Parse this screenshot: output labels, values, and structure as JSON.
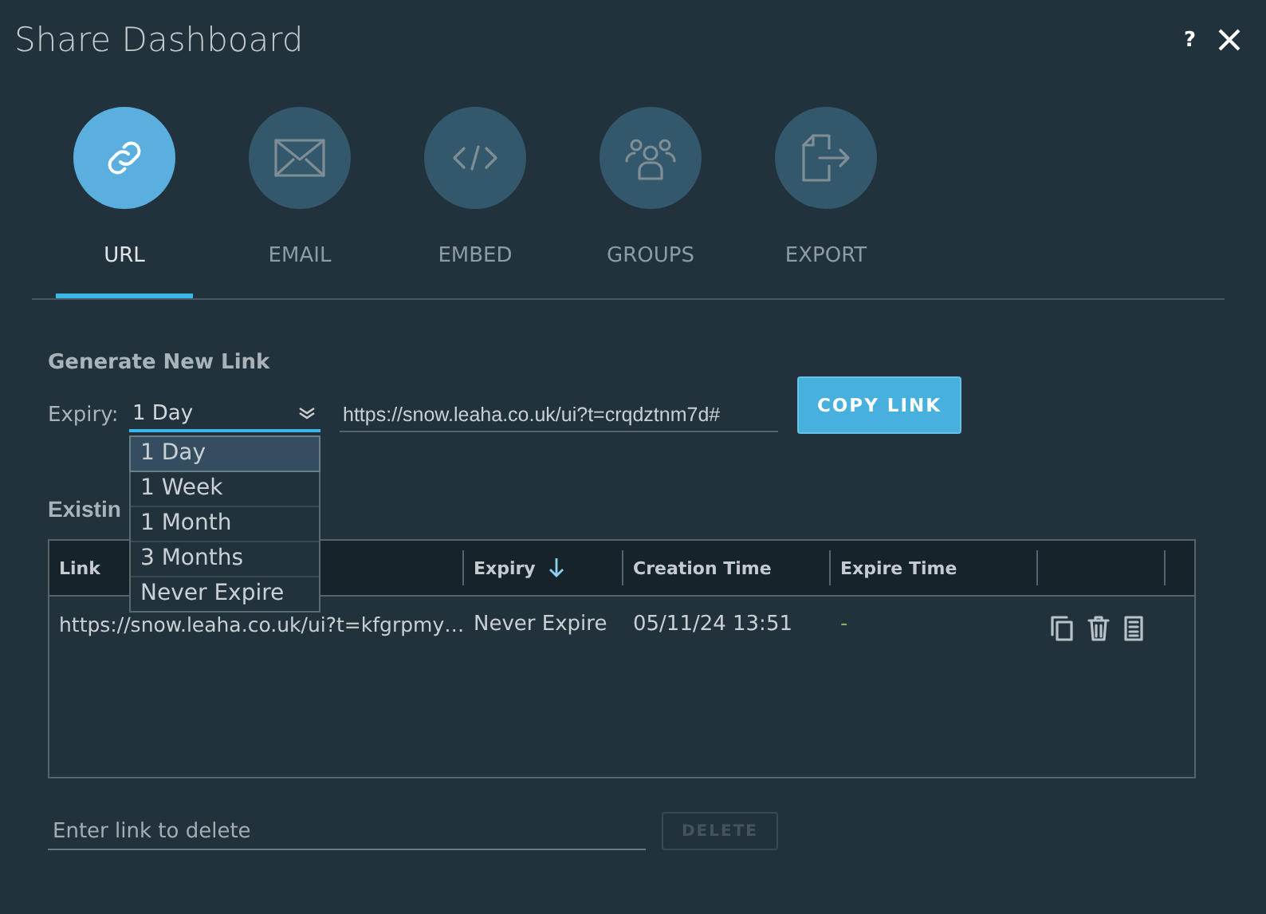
{
  "window": {
    "title": "Share Dashboard",
    "help": "?"
  },
  "tabs": [
    {
      "label": "URL",
      "selected": true
    },
    {
      "label": "EMAIL",
      "selected": false
    },
    {
      "label": "EMBED",
      "selected": false
    },
    {
      "label": "GROUPS",
      "selected": false
    },
    {
      "label": "EXPORT",
      "selected": false
    }
  ],
  "generate": {
    "heading": "Generate New Link",
    "expiry_label": "Expiry:",
    "expiry_value": "1 Day",
    "url": "https://snow.leaha.co.uk/ui?t=crqdztnm7d#",
    "copy_button": "COPY LINK",
    "options": [
      {
        "label": "1 Day",
        "selected": true
      },
      {
        "label": "1 Week",
        "selected": false
      },
      {
        "label": "1 Month",
        "selected": false
      },
      {
        "label": "3 Months",
        "selected": false
      },
      {
        "label": "Never Expire",
        "selected": false
      }
    ]
  },
  "existing": {
    "heading": "Existin",
    "table": {
      "columns": [
        {
          "label": "Link",
          "sorted": false
        },
        {
          "label": "Expiry",
          "sorted": true
        },
        {
          "label": "Creation Time",
          "sorted": false
        },
        {
          "label": "Expire Time",
          "sorted": false
        }
      ],
      "rows": [
        {
          "cells": [
            "https://snow.leaha.co.uk/ui?t=kfgrpmy…",
            "Never Expire",
            "05/11/24 13:51",
            "-"
          ]
        }
      ]
    }
  },
  "delete": {
    "placeholder": "Enter link to delete",
    "button": "DELETE",
    "disabled": true
  }
}
